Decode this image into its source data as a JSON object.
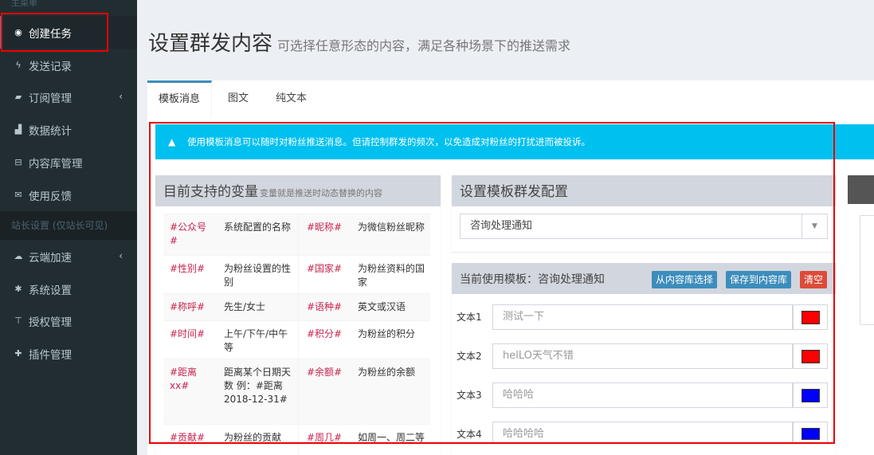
{
  "sidebar": {
    "header": "主菜单",
    "items": [
      {
        "icon": "dashboard-icon",
        "glyph": "◉",
        "label": "创建任务",
        "active": true
      },
      {
        "icon": "bolt-icon",
        "glyph": "ϟ",
        "label": "发送记录"
      },
      {
        "icon": "book-icon",
        "glyph": "▰",
        "label": "订阅管理",
        "has_children": true
      },
      {
        "icon": "area-chart-icon",
        "glyph": "▟",
        "label": "数据统计"
      },
      {
        "icon": "hdd-icon",
        "glyph": "⊟",
        "label": "内容库管理"
      },
      {
        "icon": "envelope-icon",
        "glyph": "✉",
        "label": "使用反馈"
      }
    ],
    "group_label": "站长设置 (仅站长可见)",
    "items2": [
      {
        "icon": "cloud-icon",
        "glyph": "☁",
        "label": "云端加速",
        "has_children": true
      },
      {
        "icon": "asterisk-icon",
        "glyph": "✱",
        "label": "系统设置"
      },
      {
        "icon": "cart-icon",
        "glyph": "⊤",
        "label": "授权管理"
      },
      {
        "icon": "puzzle-icon",
        "glyph": "✚",
        "label": "插件管理"
      }
    ],
    "chevron": "‹"
  },
  "header": {
    "title": "设置群发内容",
    "subtitle": "可选择任意形态的内容，满足各种场景下的推送需求"
  },
  "tabs": [
    {
      "label": "模板消息",
      "active": true
    },
    {
      "label": "图文"
    },
    {
      "label": "纯文本"
    }
  ],
  "alert": {
    "icon": "▲",
    "text": "使用模板消息可以随时对粉丝推送消息。但请控制群发的频次，以免造成对粉丝的打扰进而被投诉。"
  },
  "variables_box": {
    "title": "目前支持的变量",
    "subtitle": "变量就是推送时动态替换的内容",
    "rows": [
      [
        {
          "key": "#公众号#",
          "desc": "系统配置的名称"
        },
        {
          "key": "#昵称#",
          "desc": "为微信粉丝昵称"
        }
      ],
      [
        {
          "key": "#性别#",
          "desc": "为粉丝设置的性别"
        },
        {
          "key": "#国家#",
          "desc": "为粉丝资料的国家"
        }
      ],
      [
        {
          "key": "#称呼#",
          "desc": "先生/女士"
        },
        {
          "key": "#语种#",
          "desc": "英文或汉语"
        }
      ],
      [
        {
          "key": "#时间#",
          "desc": "上午/下午/中午等"
        },
        {
          "key": "#积分#",
          "desc": "为粉丝的积分"
        }
      ],
      [
        {
          "key": "#距离xx#",
          "desc": "距离某个日期天数 例：#距离2018-12-31#"
        },
        {
          "key": "#余额#",
          "desc": "为粉丝的余额"
        }
      ],
      [
        {
          "key": "#贡献#",
          "desc": "为粉丝的贡献"
        },
        {
          "key": "#周几#",
          "desc": "如周一、周二等"
        }
      ]
    ]
  },
  "config_box": {
    "title": "设置模板群发配置",
    "selected_template": "咨询处理通知"
  },
  "template_box": {
    "title": "当前使用模板：咨询处理通知",
    "btn_select": "从内容库选择",
    "btn_save": "保存到内容库",
    "btn_clear": "清空",
    "fields": [
      {
        "label": "文本1",
        "value": "测试一下",
        "color": "#ff0000"
      },
      {
        "label": "文本2",
        "value": "helLO天气不错",
        "color": "#ff0000"
      },
      {
        "label": "文本3",
        "value": "哈哈哈",
        "color": "#0000ff"
      },
      {
        "label": "文本4",
        "value": "哈哈哈哈",
        "color": "#0000ff"
      }
    ]
  },
  "colors": {
    "sidebar_bg": "#222d32",
    "alert_bg": "#00c0ef",
    "primary": "#3c8dbc",
    "danger": "#dd4b39",
    "variable_key": "#c7254e",
    "highlight_box": "#ee0000"
  }
}
